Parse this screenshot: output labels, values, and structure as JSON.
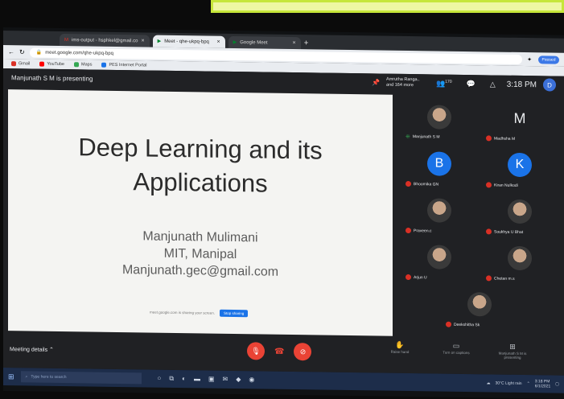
{
  "browser": {
    "tabs": [
      {
        "label": "ims-output - hsphkel@gmail.co",
        "icon": "gmail-icon"
      },
      {
        "label": "Meet - qhe-ukpq-bpq",
        "icon": "meet-icon",
        "active": true
      },
      {
        "label": "Google Meet",
        "icon": "meet-icon"
      }
    ],
    "url": "meet.google.com/qhe-ukpq-bpq",
    "bookmarks": [
      {
        "label": "Gmail",
        "color": "#d93025"
      },
      {
        "label": "YouTube",
        "color": "#ff0000"
      },
      {
        "label": "Maps",
        "color": "#34a853"
      },
      {
        "label": "PES Internet Portal",
        "color": "#1a73e8"
      }
    ]
  },
  "meet": {
    "presenter_text": "Manjunath S M is presenting",
    "pinned": "Amrutha Ranga.. and 164 more",
    "time": "3:18 PM",
    "self_initial": "D",
    "participant_count": "170",
    "slide": {
      "title_line1": "Deep Learning and its",
      "title_line2": "Applications",
      "author_name": "Manjunath Mulimani",
      "author_affil": "MIT, Manipal",
      "author_email": "Manjunath.gec@gmail.com",
      "share_notice": "meet.google.com is sharing your screen.",
      "stop_sharing": "Stop sharing"
    },
    "participants": [
      {
        "name": "Manjunath S M",
        "type": "photo",
        "speaking": true
      },
      {
        "name": "Madhsha M",
        "type": "letter",
        "letter": "M",
        "muted": true
      },
      {
        "name": "Bhoomika GN",
        "type": "letter",
        "letter": "B",
        "muted": true
      },
      {
        "name": "Kiran Nulkodi",
        "type": "letter",
        "letter": "K",
        "muted": true
      },
      {
        "name": "Praveen.c",
        "type": "photo",
        "muted": true
      },
      {
        "name": "Soukhya U Bhat",
        "type": "photo",
        "muted": true
      },
      {
        "name": "Arjun U",
        "type": "photo",
        "muted": true
      },
      {
        "name": "Chetan m.s",
        "type": "photo",
        "muted": true
      },
      {
        "name": "Deekshitha Sk",
        "type": "photo",
        "muted": true
      }
    ],
    "meeting_details": "Meeting details",
    "actions": [
      {
        "label": "Raise hand",
        "icon": "hand-icon"
      },
      {
        "label": "Turn on captions",
        "icon": "captions-icon"
      },
      {
        "label": "Manjunath S M is presenting",
        "icon": "present-icon"
      }
    ]
  },
  "taskbar": {
    "search_placeholder": "Type here to search",
    "weather": "30°C Light rain",
    "time": "3:18 PM",
    "date": "6/1/2021"
  },
  "colors": {
    "accent": "#1a73e8",
    "danger": "#ea4335",
    "meet_bg": "#202124",
    "highlight_box": "#c6e63a"
  }
}
